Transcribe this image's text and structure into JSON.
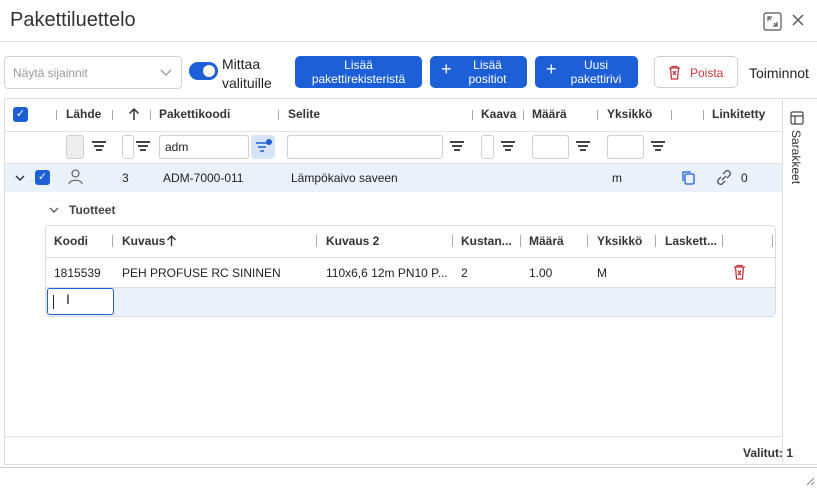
{
  "dialog": {
    "title": "Pakettiluettelo"
  },
  "toolbar": {
    "location_placeholder": "Näytä sijainnit",
    "toggle_label_line1": "Mittaa",
    "toggle_label_line2": "valituille",
    "toggle_on": true,
    "btn_add_from_registry_1": "Lisää",
    "btn_add_from_registry_2": "pakettirekisteristä",
    "btn_add_positions_1": "Lisää",
    "btn_add_positions_2": "positiot",
    "btn_new_row_1": "Uusi",
    "btn_new_row_2": "pakettirivi",
    "btn_delete": "Poista",
    "actions": "Toiminnot"
  },
  "columns": {
    "source": "Lähde",
    "package_code": "Pakettikoodi",
    "description": "Selite",
    "formula": "Kaava",
    "quantity": "Määrä",
    "unit": "Yksikkö",
    "linked": "Linkitetty"
  },
  "filters": {
    "package_code_value": "adm"
  },
  "rows": [
    {
      "order": "3",
      "code": "ADM-7000-011",
      "description": "Lämpökaivo saveen",
      "unit": "m",
      "linked_count": "0"
    }
  ],
  "subgrid": {
    "section_title": "Tuotteet",
    "columns": {
      "code": "Koodi",
      "description": "Kuvaus",
      "description2": "Kuvaus 2",
      "cost": "Kustan...",
      "quantity": "Määrä",
      "unit": "Yksikkö",
      "calc": "Laskett..."
    },
    "rows": [
      {
        "code": "1815539",
        "description": "PEH PROFUSE RC SININEN",
        "description2": "110x6,6 12m PN10 P...",
        "cost": "2",
        "quantity": "1.00",
        "unit": "M"
      }
    ]
  },
  "side_panel": {
    "label": "Sarakkeet"
  },
  "footer": {
    "selected": "Valitut: 1"
  },
  "colors": {
    "accent": "#1c5fd6",
    "danger": "#c73636",
    "selected_row": "#eaf1fb"
  }
}
